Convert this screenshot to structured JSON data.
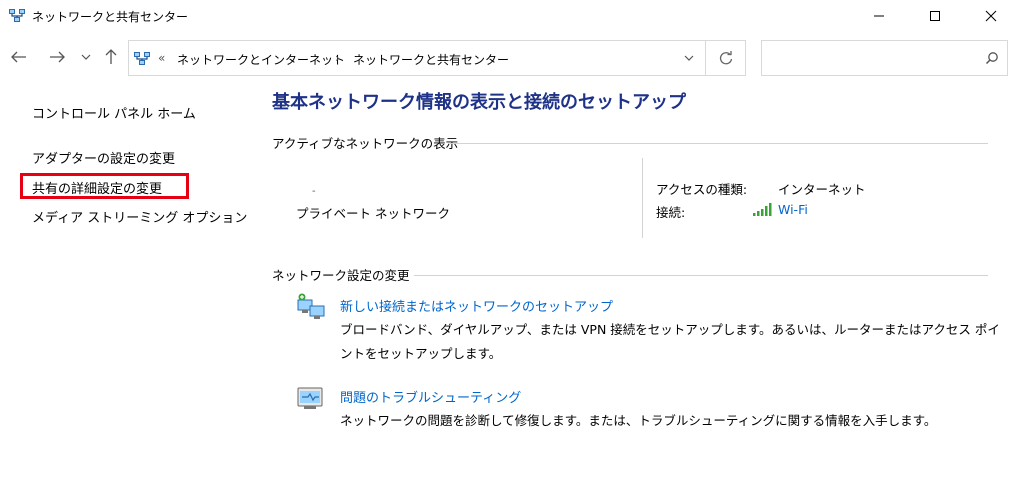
{
  "window": {
    "title": "ネットワークと共有センター"
  },
  "nav": {
    "breadcrumb_overflow": "«",
    "breadcrumb": [
      "ネットワークとインターネット",
      "ネットワークと共有センター"
    ],
    "breadcrumb_sep": "›",
    "search_placeholder": ""
  },
  "sidebar": {
    "items": [
      {
        "label": "コントロール パネル ホーム"
      },
      {
        "label": "アダプターの設定の変更"
      },
      {
        "label": "共有の詳細設定の変更"
      },
      {
        "label": "メディア ストリーミング オプション"
      }
    ]
  },
  "main": {
    "title": "基本ネットワーク情報の表示と接続のセットアップ",
    "active_section": "アクティブなネットワークの表示",
    "network": {
      "dot": "-",
      "name": "プライベート ネットワーク",
      "access_label": "アクセスの種類:",
      "access_value": "インターネット",
      "connection_label": "接続:",
      "connection_value": "Wi-Fi"
    },
    "change_section": "ネットワーク設定の変更",
    "tasks": [
      {
        "link": "新しい接続またはネットワークのセットアップ",
        "desc": "ブロードバンド、ダイヤルアップ、または VPN 接続をセットアップします。あるいは、ルーターまたはアクセス ポイントをセットアップします。"
      },
      {
        "link": "問題のトラブルシューティング",
        "desc": "ネットワークの問題を診断して修復します。または、トラブルシューティングに関する情報を入手します。"
      }
    ]
  },
  "colors": {
    "title_blue": "#1e3287",
    "link_blue": "#0066cc",
    "highlight_red": "#e60012",
    "wifi_green": "#3aa335"
  }
}
